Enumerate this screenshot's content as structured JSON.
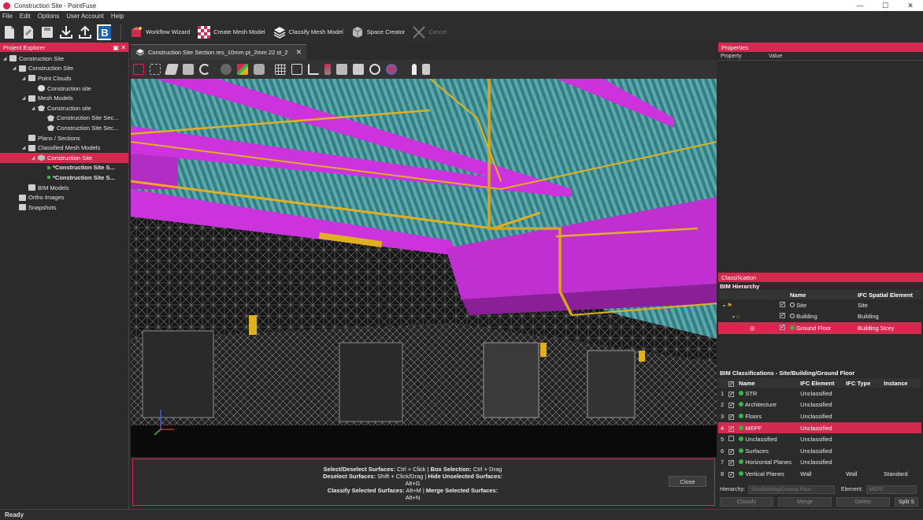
{
  "window": {
    "title": "Construction Site - PointFuse"
  },
  "menu": [
    "File",
    "Edit",
    "Options",
    "User Account",
    "Help"
  ],
  "ribbon": {
    "workflow_wizard": "Workflow Wizard",
    "create_mesh_model": "Create Mesh Model",
    "classify_mesh_model": "Classify Mesh Model",
    "space_creator": "Space Creator",
    "cancel": "Cancel"
  },
  "project_explorer": {
    "title": "Project Explorer",
    "items": [
      {
        "label": "Construction Site",
        "depth": 0,
        "icon": "folder"
      },
      {
        "label": "Construction Site",
        "depth": 1,
        "icon": "folder"
      },
      {
        "label": "Point Clouds",
        "depth": 2,
        "icon": "folder"
      },
      {
        "label": "Construction site",
        "depth": 3,
        "icon": "cloud"
      },
      {
        "label": "Mesh Models",
        "depth": 2,
        "icon": "folder"
      },
      {
        "label": "Construction site",
        "depth": 3,
        "icon": "mesh-group"
      },
      {
        "label": "Construction Site Sec...",
        "depth": 4,
        "icon": "mesh"
      },
      {
        "label": "Construction Site Sec...",
        "depth": 4,
        "icon": "mesh"
      },
      {
        "label": "Plans / Sections",
        "depth": 2,
        "icon": "folder"
      },
      {
        "label": "Classified Mesh Models",
        "depth": 2,
        "icon": "folder"
      },
      {
        "label": "Construction Site",
        "depth": 3,
        "icon": "classified",
        "selected": true
      },
      {
        "label": "*Construction Site S...",
        "depth": 4,
        "icon": "green-dot",
        "bold": true
      },
      {
        "label": "*Construction Site S...",
        "depth": 4,
        "icon": "green-dot",
        "bold": true
      },
      {
        "label": "BIM Models",
        "depth": 2,
        "icon": "folder"
      },
      {
        "label": "Ortho Images",
        "depth": 1,
        "icon": "folder"
      },
      {
        "label": "Snapshots",
        "depth": 1,
        "icon": "folder"
      }
    ]
  },
  "document_tab": {
    "label": "Construction Site Section res_10mm pt_2mm 22 st_2"
  },
  "hints": {
    "line1_a": "Select/Deselect Surfaces:",
    "line1_b": " Ctrl + Click | ",
    "line1_c": "Box Selection:",
    "line1_d": " Ctrl + Drag",
    "line2_a": "Deselect Surfaces:",
    "line2_b": " Shift + Click/Drag | ",
    "line2_c": "Hide Unselected Surfaces:",
    "line3": "Alt+G",
    "line4_a": "Classify Selected Surfaces:",
    "line4_b": " Alt+M | ",
    "line4_c": "Merge Selected Surfaces:",
    "line5": "Alt+N",
    "close": "Close"
  },
  "properties": {
    "title": "Properties",
    "col_property": "Property",
    "col_value": "Value"
  },
  "classification": {
    "title": "Classification",
    "hierarchy_title": "BIM Hierarchy",
    "hierarchy_cols": {
      "name": "Name",
      "ifc": "IFC Spatial Element"
    },
    "hierarchy": [
      {
        "name": "Site",
        "ifc": "Site"
      },
      {
        "name": "Building",
        "ifc": "Building"
      },
      {
        "name": "Ground Floor",
        "ifc": "Building Story"
      }
    ],
    "classifications_title": "BIM Classifications - Site/Building/Ground Floor",
    "class_cols": {
      "name": "Name",
      "ifc_element": "IFC Element",
      "ifc_type": "IFC Type",
      "instance": "Instance"
    },
    "rows": [
      {
        "num": "1",
        "checked": true,
        "name": "STR",
        "ifc_element": "Unclassified",
        "ifc_type": "",
        "instance": ""
      },
      {
        "num": "2",
        "checked": true,
        "name": "Architecture",
        "ifc_element": "Unclassified",
        "ifc_type": "",
        "instance": ""
      },
      {
        "num": "3",
        "checked": true,
        "name": "Floors",
        "ifc_element": "Unclassified",
        "ifc_type": "",
        "instance": ""
      },
      {
        "num": "4",
        "checked": true,
        "name": "MEPF",
        "ifc_element": "Unclassified",
        "ifc_type": "",
        "instance": ""
      },
      {
        "num": "5",
        "checked": false,
        "name": "Unclassified",
        "ifc_element": "Unclassified",
        "ifc_type": "",
        "instance": ""
      },
      {
        "num": "6",
        "checked": true,
        "name": "Surfaces",
        "ifc_element": "Unclassified",
        "ifc_type": "",
        "instance": ""
      },
      {
        "num": "7",
        "checked": true,
        "name": "Horizontal Planes",
        "ifc_element": "Unclassified",
        "ifc_type": "",
        "instance": ""
      },
      {
        "num": "8",
        "checked": true,
        "name": "Vertical Planes",
        "ifc_element": "Wall",
        "ifc_type": "Wall",
        "instance": "Standard"
      }
    ],
    "hierarchy_label": "Hierarchy:",
    "hierarchy_value": "Site/Building/Ground Floor",
    "element_label": "Element:",
    "element_value": "MEPF",
    "btn_classify": "Classify",
    "btn_merge": "Merge",
    "btn_delete": "Delete",
    "btn_split": "Split S"
  },
  "status": {
    "text": "Ready"
  },
  "colors": {
    "accent": "#d42a4f",
    "magenta": "#cc33dd",
    "yellow": "#e0b020",
    "teal": "#3a8c8c"
  }
}
